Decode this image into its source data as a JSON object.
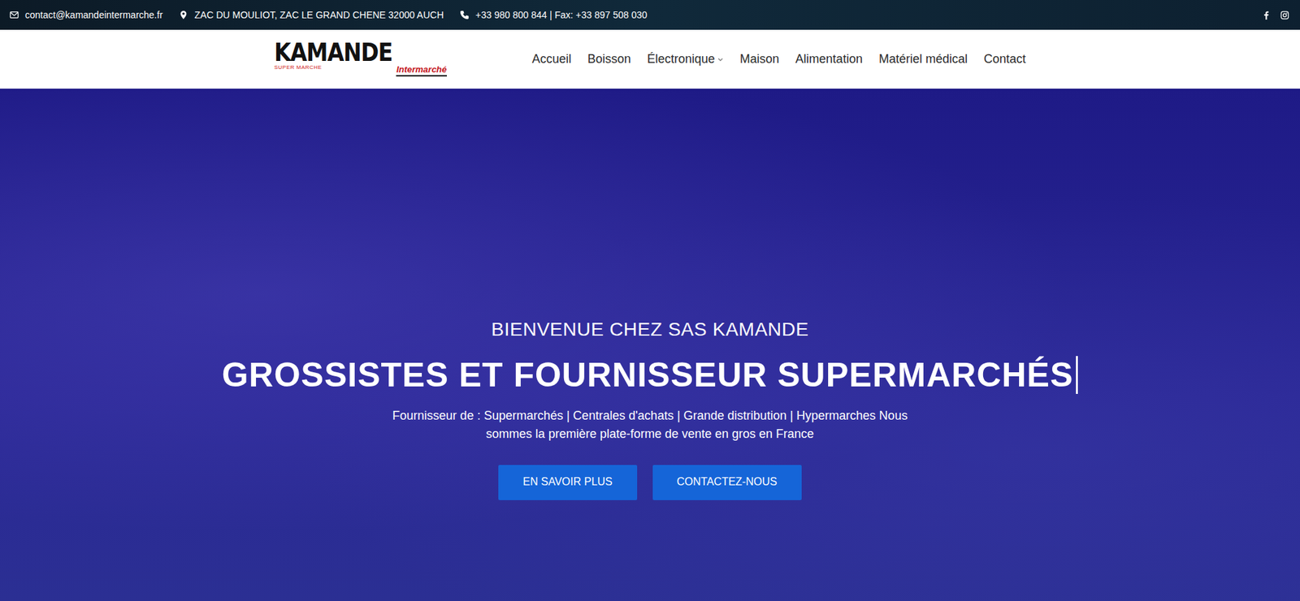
{
  "top_bar": {
    "email": "contact@kamandeintermarche.fr",
    "address": "ZAC DU MOULIOT, ZAC LE GRAND CHENE 32000 AUCH",
    "phone": "+33 980 800 844 | Fax: +33 897 508 030"
  },
  "logo": {
    "name": "KAMANDE",
    "tagline": "SUPER MARCHE",
    "partner": "Intermarché"
  },
  "nav": [
    {
      "label": "Accueil",
      "dropdown": false,
      "selected": false
    },
    {
      "label": "Boisson",
      "dropdown": false,
      "selected": false
    },
    {
      "label": "Électronique",
      "dropdown": true,
      "selected": false
    },
    {
      "label": "Maison",
      "dropdown": false,
      "selected": false
    },
    {
      "label": "Alimentation",
      "dropdown": false,
      "selected": false
    },
    {
      "label": "Matériel médical",
      "dropdown": false,
      "selected": false
    },
    {
      "label": "Contact",
      "dropdown": false,
      "selected": false
    }
  ],
  "hero": {
    "eyebrow": "BIENVENUE CHEZ SAS KAMANDE",
    "title": "GROSSISTES ET FOURNISSEUR SUPERMARCHÉS",
    "text": "Fournisseur de : Supermarchés | Centrales d'achats | Grande distribution | Hypermarches Nous sommes la première plate-forme de vente en gros en France",
    "buttons": [
      "EN SAVOIR PLUS",
      "CONTACTEZ-NOUS"
    ]
  }
}
